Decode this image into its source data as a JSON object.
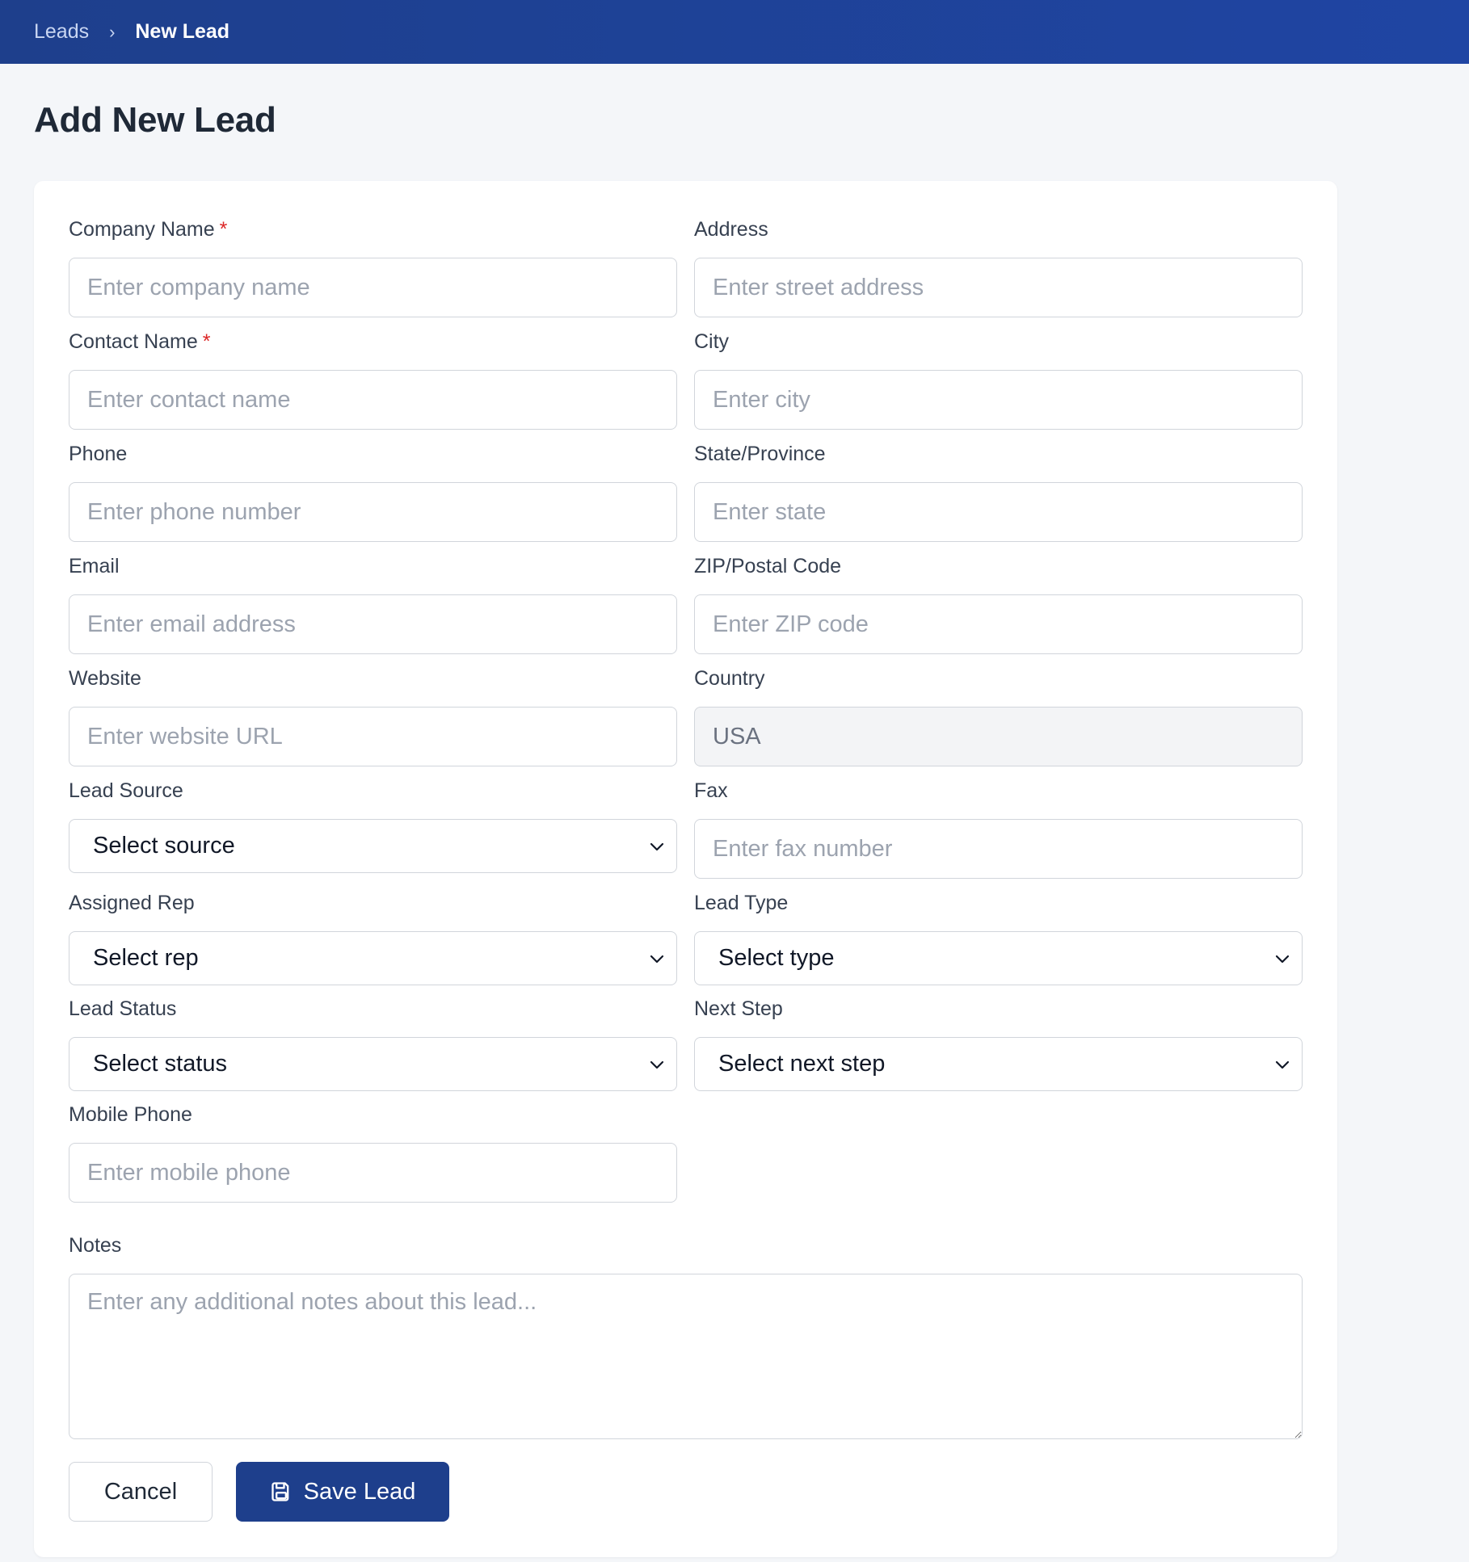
{
  "breadcrumb": {
    "parent": "Leads",
    "separator": "›",
    "current": "New Lead"
  },
  "page_title": "Add New Lead",
  "required_marker": "*",
  "form": {
    "company_name": {
      "label": "Company Name",
      "required": true,
      "placeholder": "Enter company name",
      "value": ""
    },
    "contact_name": {
      "label": "Contact Name",
      "required": true,
      "placeholder": "Enter contact name",
      "value": ""
    },
    "phone": {
      "label": "Phone",
      "placeholder": "Enter phone number",
      "value": ""
    },
    "email": {
      "label": "Email",
      "placeholder": "Enter email address",
      "value": ""
    },
    "website": {
      "label": "Website",
      "placeholder": "Enter website URL",
      "value": ""
    },
    "lead_source": {
      "label": "Lead Source",
      "selected": "Select source"
    },
    "assigned_rep": {
      "label": "Assigned Rep",
      "selected": "Select rep"
    },
    "lead_status": {
      "label": "Lead Status",
      "selected": "Select status"
    },
    "mobile_phone": {
      "label": "Mobile Phone",
      "placeholder": "Enter mobile phone",
      "value": ""
    },
    "address": {
      "label": "Address",
      "placeholder": "Enter street address",
      "value": ""
    },
    "city": {
      "label": "City",
      "placeholder": "Enter city",
      "value": ""
    },
    "state": {
      "label": "State/Province",
      "placeholder": "Enter state",
      "value": ""
    },
    "zip": {
      "label": "ZIP/Postal Code",
      "placeholder": "Enter ZIP code",
      "value": ""
    },
    "country": {
      "label": "Country",
      "value": "USA"
    },
    "fax": {
      "label": "Fax",
      "placeholder": "Enter fax number",
      "value": ""
    },
    "lead_type": {
      "label": "Lead Type",
      "selected": "Select type"
    },
    "next_step": {
      "label": "Next Step",
      "selected": "Select next step"
    },
    "notes": {
      "label": "Notes",
      "placeholder": "Enter any additional notes about this lead..."
    }
  },
  "actions": {
    "cancel_label": "Cancel",
    "save_label": "Save Lead",
    "save_icon": "save-icon"
  },
  "colors": {
    "header_bg": "#1e3f8c",
    "primary_button": "#1e3f8c",
    "required_star": "#dc2626",
    "page_bg": "#f4f6f9"
  }
}
